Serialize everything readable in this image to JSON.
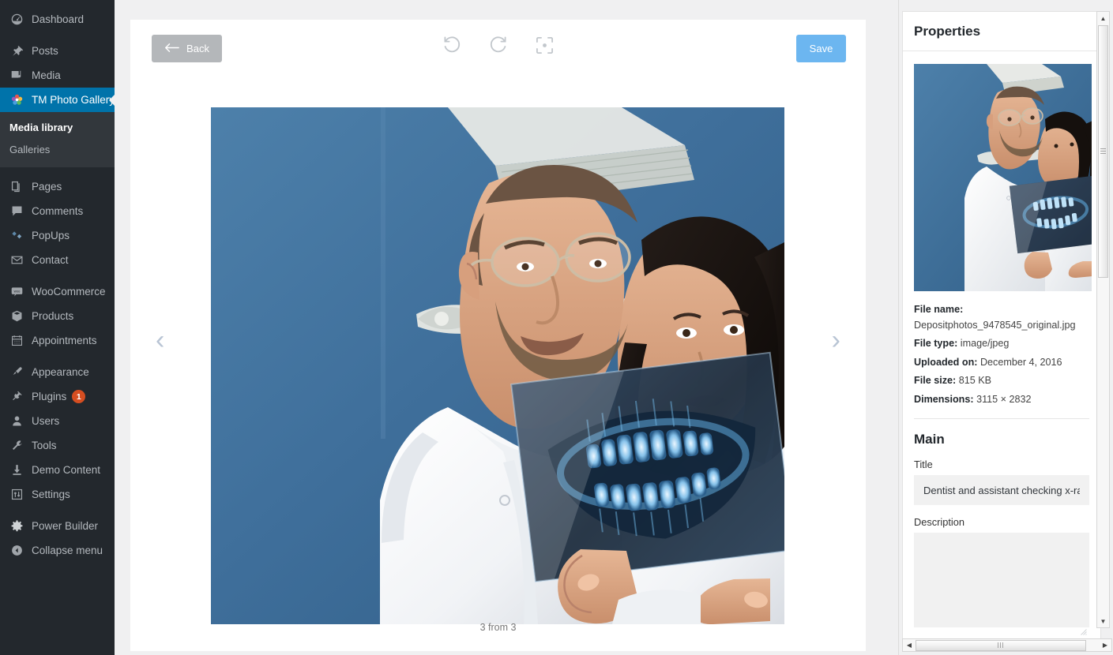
{
  "sidebar": {
    "items": [
      {
        "label": "Dashboard",
        "icon": "dashboard-icon"
      },
      {
        "label": "Posts",
        "icon": "pin-icon"
      },
      {
        "label": "Media",
        "icon": "media-icon"
      },
      {
        "label": "TM Photo Gallery",
        "icon": "gallery-flower-icon",
        "active": true
      },
      {
        "label": "Pages",
        "icon": "pages-icon"
      },
      {
        "label": "Comments",
        "icon": "comments-icon"
      },
      {
        "label": "PopUps",
        "icon": "popups-icon"
      },
      {
        "label": "Contact",
        "icon": "envelope-icon"
      },
      {
        "label": "WooCommerce",
        "icon": "woocommerce-icon"
      },
      {
        "label": "Products",
        "icon": "products-box-icon"
      },
      {
        "label": "Appointments",
        "icon": "calendar-icon"
      },
      {
        "label": "Appearance",
        "icon": "brush-icon"
      },
      {
        "label": "Plugins",
        "icon": "plug-icon",
        "badge": "1"
      },
      {
        "label": "Users",
        "icon": "user-icon"
      },
      {
        "label": "Tools",
        "icon": "wrench-icon"
      },
      {
        "label": "Demo Content",
        "icon": "download-icon"
      },
      {
        "label": "Settings",
        "icon": "settings-sliders-icon"
      },
      {
        "label": "Power Builder",
        "icon": "gear-icon"
      },
      {
        "label": "Collapse menu",
        "icon": "collapse-arrow-icon"
      }
    ],
    "submenu": [
      {
        "label": "Media library",
        "current": true
      },
      {
        "label": "Galleries",
        "current": false
      }
    ]
  },
  "toolbar": {
    "back_label": "Back",
    "save_label": "Save",
    "tools": [
      {
        "name": "rotate-left-icon"
      },
      {
        "name": "rotate-right-icon"
      },
      {
        "name": "focus-crop-icon"
      }
    ]
  },
  "viewer": {
    "prev_arrow": "‹",
    "next_arrow": "›",
    "counter": "3 from 3"
  },
  "properties": {
    "title": "Properties",
    "meta": {
      "file_name_label": "File name:",
      "file_name_value": "Depositphotos_9478545_original.jpg",
      "file_type_label": "File type:",
      "file_type_value": "image/jpeg",
      "uploaded_label": "Uploaded on:",
      "uploaded_value": "December 4, 2016",
      "file_size_label": "File size:",
      "file_size_value": "815 KB",
      "dimensions_label": "Dimensions:",
      "dimensions_value": "3115 × 2832"
    },
    "main": {
      "section_title": "Main",
      "title_label": "Title",
      "title_value": "Dentist and assistant checking x-ray",
      "description_label": "Description",
      "description_value": ""
    }
  },
  "colors": {
    "sidebar_bg": "#23282d",
    "submenu_bg": "#32373c",
    "active_blue": "#0073aa",
    "save_blue": "#6cb6f0",
    "back_gray": "#b4b7ba",
    "badge_orange": "#d54e21",
    "page_bg": "#f0f0f1"
  }
}
